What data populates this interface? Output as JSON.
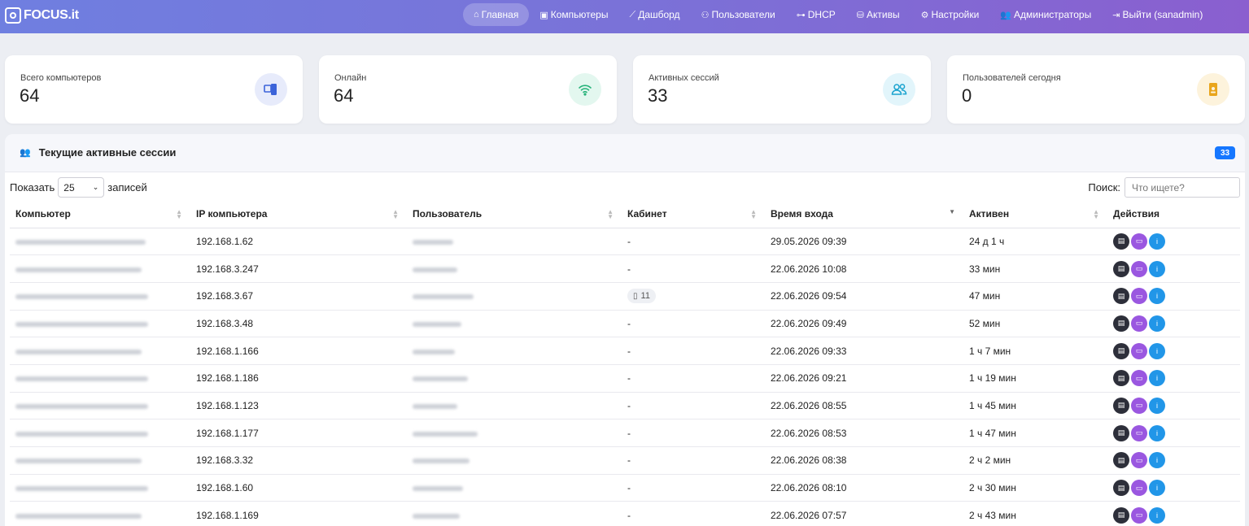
{
  "brand": {
    "name": "FOCUS.it"
  },
  "nav": [
    {
      "label": "Главная",
      "icon": "⌂",
      "active": true
    },
    {
      "label": "Компьютеры",
      "icon": "▣"
    },
    {
      "label": "Дашборд",
      "icon": "⟋"
    },
    {
      "label": "Пользователи",
      "icon": "⚇"
    },
    {
      "label": "DHCP",
      "icon": "⊶"
    },
    {
      "label": "Активы",
      "icon": "⛁"
    },
    {
      "label": "Настройки",
      "icon": "⚙"
    },
    {
      "label": "Администраторы",
      "icon": "👥"
    },
    {
      "label": "Выйти (sanadmin)",
      "icon": "⇥"
    }
  ],
  "stats": [
    {
      "label": "Всего компьютеров",
      "value": "64",
      "icon": "computer-icon",
      "bg": "#e7ebfb",
      "fg": "#3b63d9"
    },
    {
      "label": "Онлайн",
      "value": "64",
      "icon": "wifi-icon",
      "bg": "#e3f7ef",
      "fg": "#27b37a"
    },
    {
      "label": "Активных сессий",
      "value": "33",
      "icon": "users-icon",
      "bg": "#e2f5fb",
      "fg": "#1aa3cf"
    },
    {
      "label": "Пользователей сегодня",
      "value": "0",
      "icon": "badge-icon",
      "bg": "#fdf3dc",
      "fg": "#e9a51c"
    }
  ],
  "sessions": {
    "title": "Текущие активные сессии",
    "count": "33",
    "show_label": "Показать",
    "page_size": "25",
    "records_label": "записей",
    "search_label": "Поиск:",
    "search_placeholder": "Что ищете?",
    "columns": [
      "Компьютер",
      "IP компьютера",
      "Пользователь",
      "Кабинет",
      "Время входа",
      "Активен",
      "Действия"
    ],
    "rows": [
      {
        "ip": "192.168.1.62",
        "room": "-",
        "login": "29.05.2026 09:39",
        "active": "24 д 1 ч"
      },
      {
        "ip": "192.168.3.247",
        "room": "-",
        "login": "22.06.2026 10:08",
        "active": "33 мин"
      },
      {
        "ip": "192.168.3.67",
        "room": "11",
        "login": "22.06.2026 09:54",
        "active": "47 мин"
      },
      {
        "ip": "192.168.3.48",
        "room": "-",
        "login": "22.06.2026 09:49",
        "active": "52 мин"
      },
      {
        "ip": "192.168.1.166",
        "room": "-",
        "login": "22.06.2026 09:33",
        "active": "1 ч 7 мин"
      },
      {
        "ip": "192.168.1.186",
        "room": "-",
        "login": "22.06.2026 09:21",
        "active": "1 ч 19 мин"
      },
      {
        "ip": "192.168.1.123",
        "room": "-",
        "login": "22.06.2026 08:55",
        "active": "1 ч 45 мин"
      },
      {
        "ip": "192.168.1.177",
        "room": "-",
        "login": "22.06.2026 08:53",
        "active": "1 ч 47 мин"
      },
      {
        "ip": "192.168.3.32",
        "room": "-",
        "login": "22.06.2026 08:38",
        "active": "2 ч 2 мин"
      },
      {
        "ip": "192.168.1.60",
        "room": "-",
        "login": "22.06.2026 08:10",
        "active": "2 ч 30 мин"
      },
      {
        "ip": "192.168.1.169",
        "room": "-",
        "login": "22.06.2026 07:57",
        "active": "2 ч 43 мин"
      }
    ]
  }
}
